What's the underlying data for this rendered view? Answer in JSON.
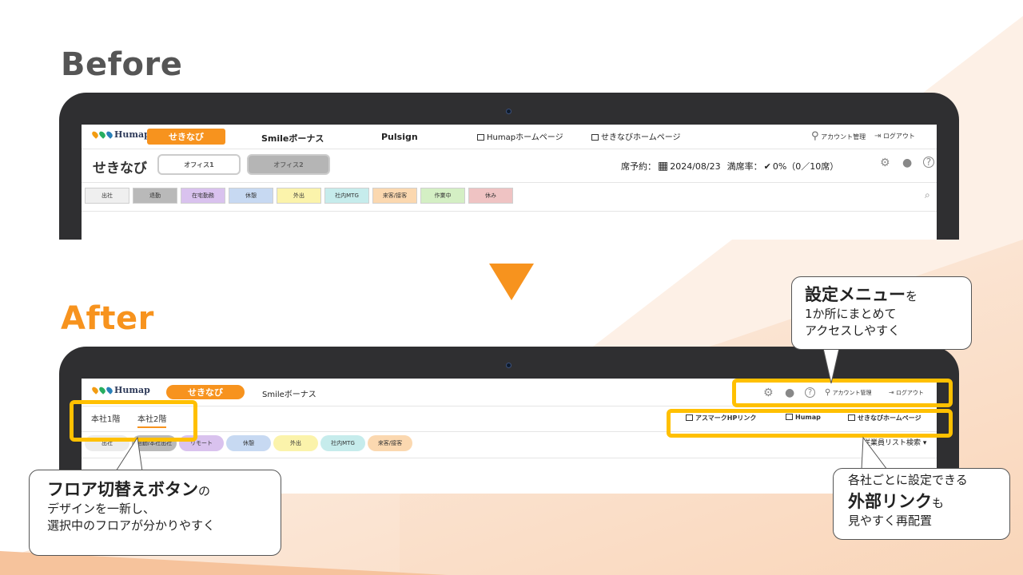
{
  "headings": {
    "before": "Before",
    "after": "After"
  },
  "colors": {
    "accent": "#F7931E",
    "highlight": "#FFC000",
    "device": "#2f2f31"
  },
  "before": {
    "logo": "Humap",
    "nav": {
      "active_tab": "せきなび",
      "smile": "Smileボーナス",
      "pulsign": "Pulsign",
      "humap_home": "Humapホームページ",
      "sekinavi_home": "せきなびホームページ",
      "account": "アカウント管理",
      "logout": "ログアウト"
    },
    "page_title": "せきなび",
    "office_tabs": [
      "オフィス1",
      "オフィス2"
    ],
    "reservation_label": "席予約：",
    "date": "2024/08/23",
    "occupancy_label": "満席率：",
    "occupancy_value": "0%（0／10席）",
    "statuses": [
      {
        "label": "出社",
        "color": "#efefef"
      },
      {
        "label": "退勤",
        "color": "#b9b9b9"
      },
      {
        "label": "在宅勤務",
        "color": "#d9c2ee"
      },
      {
        "label": "休憩",
        "color": "#c7d9f2"
      },
      {
        "label": "外出",
        "color": "#fbf3ab"
      },
      {
        "label": "社内MTG",
        "color": "#c6ecec"
      },
      {
        "label": "来客/接客",
        "color": "#fbd8b0"
      },
      {
        "label": "作業中",
        "color": "#d4efc4"
      },
      {
        "label": "休み",
        "color": "#efc3c3"
      }
    ]
  },
  "after": {
    "logo": "Humap",
    "nav": {
      "active_tab": "せきなび",
      "smile": "Smileボーナス",
      "account": "アカウント管理",
      "logout": "ログアウト"
    },
    "floor_tabs": [
      "本社1階",
      "本社2階"
    ],
    "external_links": [
      "アスマークHPリンク",
      "Humap",
      "せきなびホームページ"
    ],
    "employee_search": "従業員リスト検索",
    "statuses": [
      {
        "label": "出社",
        "color": "#ececec"
      },
      {
        "label": "退勤/本社出社",
        "color": "#b9b9b9"
      },
      {
        "label": "リモート",
        "color": "#d9c2ee"
      },
      {
        "label": "休憩",
        "color": "#c7d9f2"
      },
      {
        "label": "外出",
        "color": "#fbf3ab"
      },
      {
        "label": "社内MTG",
        "color": "#c6ecec"
      },
      {
        "label": "来客/接客",
        "color": "#fbd8b0"
      }
    ]
  },
  "callouts": {
    "settings": {
      "bold": "設定メニュー",
      "tail": "を",
      "lines": [
        "1か所にまとめて",
        "アクセスしやすく"
      ]
    },
    "floor": {
      "bold": "フロア切替えボタン",
      "tail": "の",
      "lines": [
        "デザインを一新し、",
        "選択中のフロアが分かりやすく"
      ]
    },
    "links": {
      "head": "各社ごとに設定できる",
      "bold": "外部リンク",
      "tail": "も",
      "line": "見やすく再配置"
    }
  }
}
